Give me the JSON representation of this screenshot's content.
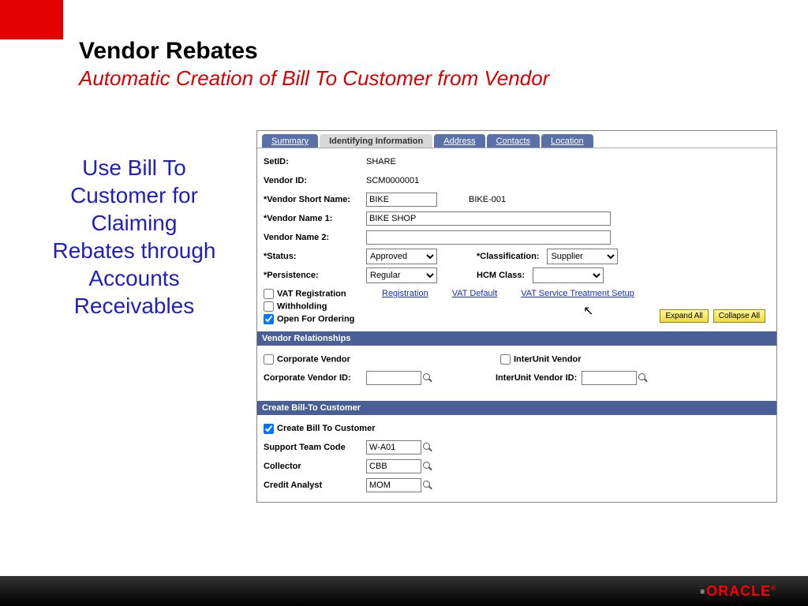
{
  "slide": {
    "title": "Vendor Rebates",
    "subtitle": "Automatic Creation of Bill To Customer from Vendor",
    "sidenote": "Use Bill To Customer for Claiming Rebates through Accounts Receivables",
    "footer_brand": "ORACLE"
  },
  "tabs": [
    "Summary",
    "Identifying Information",
    "Address",
    "Contacts",
    "Location"
  ],
  "active_tab": 1,
  "form": {
    "setid_label": "SetID:",
    "setid_value": "SHARE",
    "vendorid_label": "Vendor ID:",
    "vendorid_value": "SCM0000001",
    "shortname_label": "*Vendor Short Name:",
    "shortname_value": "BIKE",
    "shortname_suffix": "BIKE-001",
    "name1_label": "*Vendor Name 1:",
    "name1_value": "BIKE SHOP",
    "name2_label": "Vendor Name 2:",
    "name2_value": "",
    "status_label": "*Status:",
    "status_value": "Approved",
    "classification_label": "*Classification:",
    "classification_value": "Supplier",
    "persistence_label": "*Persistence:",
    "persistence_value": "Regular",
    "hcm_label": "HCM Class:",
    "hcm_value": "",
    "vatreg_label": "VAT Registration",
    "withholding_label": "Withholding",
    "openorder_label": "Open For Ordering",
    "link_registration": "Registration",
    "link_vatdefault": "VAT Default",
    "link_vatsvc": "VAT Service Treatment Setup",
    "expand_all": "Expand All",
    "collapse_all": "Collapse All"
  },
  "rel": {
    "header": "Vendor Relationships",
    "corpvendor_label": "Corporate Vendor",
    "interunit_label": "InterUnit Vendor",
    "corpid_label": "Corporate Vendor ID:",
    "corpid_value": "",
    "interid_label": "InterUnit Vendor ID:",
    "interid_value": ""
  },
  "bill": {
    "header": "Create Bill-To Customer",
    "create_label": "Create Bill To Customer",
    "team_label": "Support Team Code",
    "team_value": "W-A01",
    "collector_label": "Collector",
    "collector_value": "CBB",
    "credit_label": "Credit Analyst",
    "credit_value": "MOM"
  }
}
